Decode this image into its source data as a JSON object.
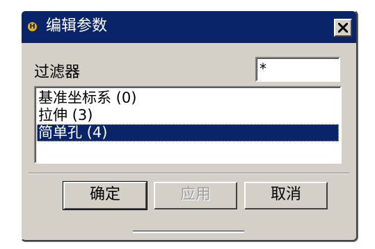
{
  "dialog": {
    "title": "编辑参数",
    "icon": "nx-app-icon",
    "icon_glyph": "H",
    "close_glyph": "close-icon"
  },
  "filter": {
    "label": "过滤器",
    "value": "*"
  },
  "list": {
    "items": [
      {
        "label": "基准坐标系 (0)",
        "selected": false
      },
      {
        "label": "拉伸 (3)",
        "selected": false
      },
      {
        "label": "简单孔 (4)",
        "selected": true
      }
    ]
  },
  "buttons": {
    "ok_label": "确定",
    "apply_label": "应用",
    "cancel_label": "取消"
  },
  "colors": {
    "titlebar": "#0a246a",
    "dialog_bg": "#d4d0c8",
    "selection": "#0a246a"
  }
}
